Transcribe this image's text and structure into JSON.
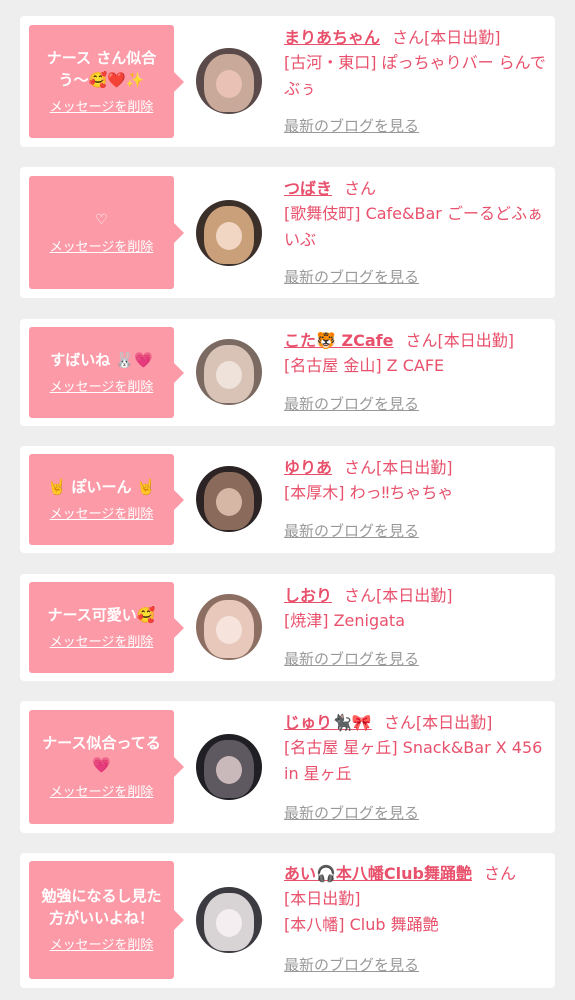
{
  "delete_label": "メッセージを削除",
  "san_label": "さん",
  "blog_label": "最新のブログを見る",
  "items": [
    {
      "message": "ナース さん似合う〜🥰❤️✨",
      "name": "まりあちゃん",
      "status": "[本日出勤]",
      "shop": "[古河・東口] ぽっちゃりバー らんでぶぅ",
      "avatar_colors": [
        "#5a4a4a",
        "#c9a99a",
        "#e9c2b5"
      ]
    },
    {
      "message": "♡",
      "name": "つばき",
      "status": "",
      "shop": "[歌舞伎町] Cafe&Bar ごーるどふぁいぶ",
      "avatar_colors": [
        "#3b2f2a",
        "#caa07a",
        "#f1d6c4"
      ]
    },
    {
      "message": "すばいね 🐰💗",
      "name": "こた🐯 ZCafe",
      "status": "[本日出勤]",
      "shop": "[名古屋 金山] Z CAFE",
      "avatar_colors": [
        "#7a6a62",
        "#d8c3b6",
        "#efe2da"
      ]
    },
    {
      "message": "🤘 ぽいーん 🤘",
      "name": "ゆりあ",
      "status": "[本日出勤]",
      "shop": "[本厚木] わっ‼ちゃちゃ",
      "avatar_colors": [
        "#2c2424",
        "#8a6a5a",
        "#d6b7a6"
      ]
    },
    {
      "message": "ナース可愛い🥰",
      "name": "しおり",
      "status": "[本日出勤]",
      "shop": "[焼津] Zenigata",
      "avatar_colors": [
        "#8c6f62",
        "#e7c8bb",
        "#f6e4dc"
      ]
    },
    {
      "message": "ナース似合ってる💗",
      "name": "じゅり🐈‍⬛🎀",
      "status": "[本日出勤]",
      "shop": "[名古屋 星ヶ丘] Snack&Bar X 456 in 星ヶ丘",
      "avatar_colors": [
        "#1f1f24",
        "#5e5860",
        "#c9b9bb"
      ]
    },
    {
      "message": "勉強になるし見た方がいいよね！",
      "name": "あい🎧本八幡Club舞踊艶",
      "status": "[本日出勤]",
      "shop": "[本八幡] Club 舞踊艶",
      "avatar_colors": [
        "#3a3a40",
        "#d8d3d4",
        "#f4eef0"
      ]
    }
  ]
}
